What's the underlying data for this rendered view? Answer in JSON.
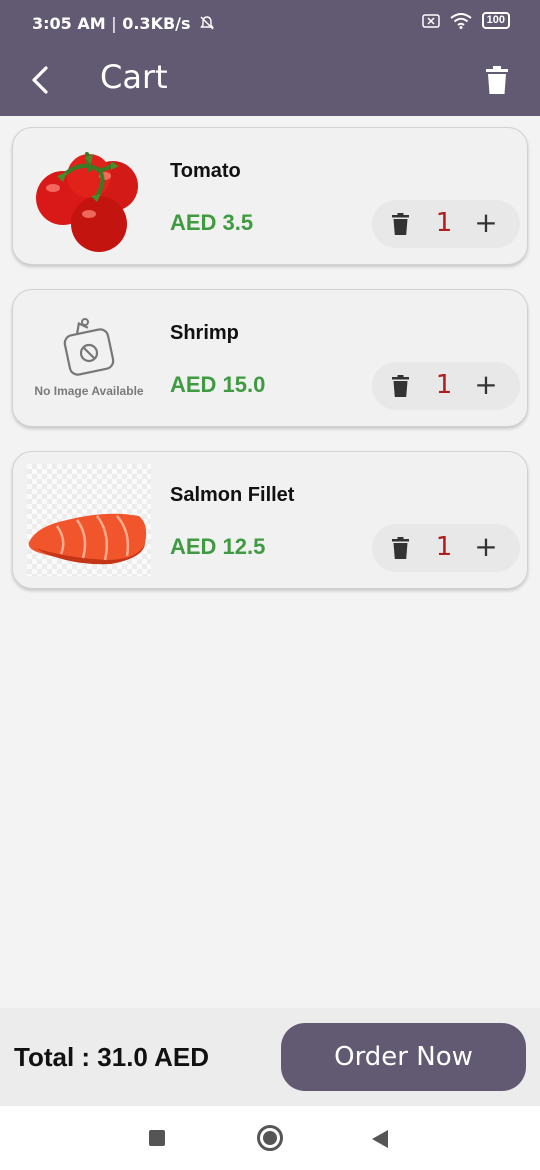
{
  "status": {
    "time": "3:05 AM",
    "separator": "|",
    "network_speed": "0.3KB/s",
    "battery": "100",
    "icons": [
      "mute-bell-icon",
      "sim-off-icon",
      "wifi-icon",
      "battery-icon"
    ]
  },
  "app_bar": {
    "title": "Cart",
    "back_icon": "chevron-left-icon",
    "clear_icon": "trash-icon"
  },
  "items": [
    {
      "name": "Tomato",
      "price": "AED 3.5",
      "quantity": "1",
      "image": "tomato-photo"
    },
    {
      "name": "Shrimp",
      "price": "AED 15.0",
      "quantity": "1",
      "image": "no-image-placeholder",
      "placeholder_text": "No Image Available"
    },
    {
      "name": "Salmon Fillet",
      "price": "AED 12.5",
      "quantity": "1",
      "image": "salmon-photo"
    }
  ],
  "quantity_controls": {
    "remove_icon": "trash-icon",
    "add_label": "+"
  },
  "footer": {
    "total_label": "Total : 31.0 AED",
    "order_button": "Order Now"
  },
  "colors": {
    "primary": "#625a72",
    "price": "#3f9a41",
    "quantity": "#b11d1d",
    "background": "#f3f3f3"
  }
}
